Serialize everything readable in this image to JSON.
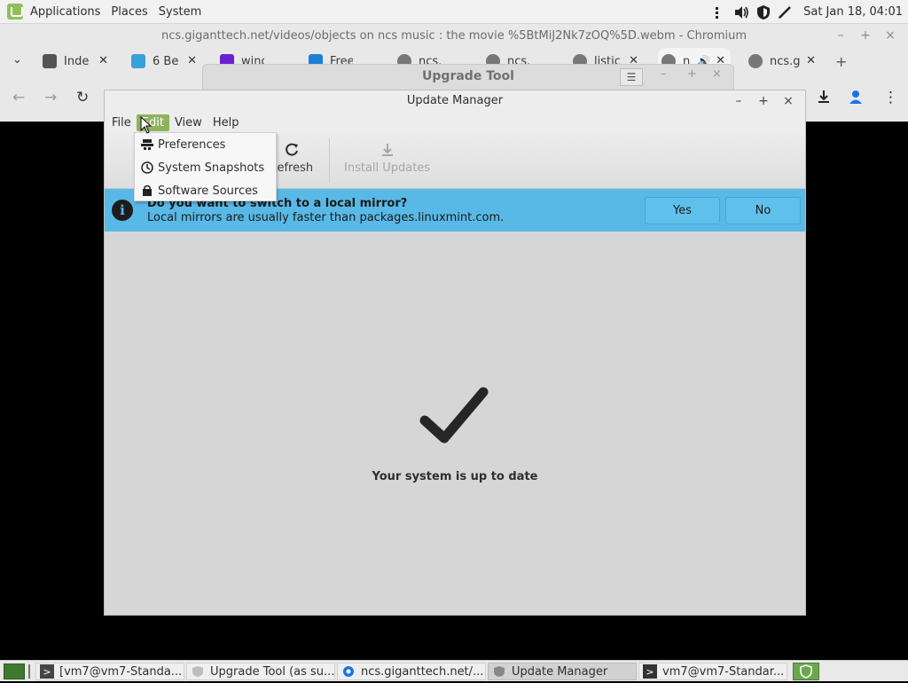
{
  "top_panel": {
    "applications": "Applications",
    "places": "Places",
    "system": "System",
    "clock": "Sat Jan 18, 04:01"
  },
  "chromium": {
    "title": "ncs.giganttech.net/videos/objects on ncs music :  the movie %5BtMiJ2Nk7zOQ%5D.webm - Chromium",
    "tabs": [
      {
        "label": "Inde",
        "icon": "tab-favicon-puzzle"
      },
      {
        "label": "6 Be",
        "icon": "tab-favicon-blue"
      },
      {
        "label": "wind",
        "icon": "tab-favicon-yahoo"
      },
      {
        "label": "Free",
        "icon": "tab-favicon-windows"
      },
      {
        "label": "ncs.g",
        "icon": "globe-icon"
      },
      {
        "label": "ncs.g",
        "icon": "globe-icon"
      },
      {
        "label": "listic",
        "icon": "globe-icon"
      },
      {
        "label": "n",
        "icon": "globe-icon"
      },
      {
        "label": "ncs.g",
        "icon": "globe-icon"
      }
    ]
  },
  "upgrade_tool": {
    "title": "Upgrade Tool"
  },
  "update_manager": {
    "title": "Update Manager",
    "menus": [
      "File",
      "Edit",
      "View",
      "Help"
    ],
    "toolbar": {
      "refresh": "Refresh",
      "install": "Install Updates"
    },
    "infobar": {
      "title": "Do you want to switch to a local mirror?",
      "message": "Local mirrors are usually faster than packages.linuxmint.com.",
      "yes": "Yes",
      "no": "No",
      "color": "#58b9e6"
    },
    "status": "Your system is up to date"
  },
  "edit_menu": {
    "items": [
      "Preferences",
      "System Snapshots",
      "Software Sources"
    ]
  },
  "taskbar": {
    "tasks": [
      {
        "label": "[vm7@vm7-Standa...",
        "icon": "terminal-icon"
      },
      {
        "label": "Upgrade Tool (as su...",
        "icon": "shield-icon"
      },
      {
        "label": "ncs.giganttech.net/...",
        "icon": "chromium-icon"
      },
      {
        "label": "Update Manager",
        "icon": "shield-icon"
      },
      {
        "label": "vm7@vm7-Standar...",
        "icon": "terminal-icon"
      }
    ]
  },
  "colors": {
    "accent": "#8fb35c",
    "info_blue": "#58b9e6"
  }
}
